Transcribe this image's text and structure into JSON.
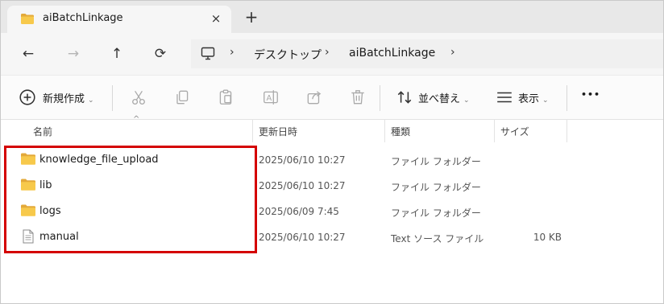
{
  "tab": {
    "title": "aiBatchLinkage",
    "close": "×",
    "new_tab": "+"
  },
  "nav": {
    "back": "←",
    "forward": "→",
    "up": "↑",
    "refresh": "⟳"
  },
  "breadcrumb": {
    "sep": "›",
    "items": [
      "デスクトップ",
      "aiBatchLinkage"
    ]
  },
  "toolbar": {
    "new_label": "新規作成",
    "sort_label": "並べ替え",
    "view_label": "表示",
    "more": "•••",
    "chevron": "⌄"
  },
  "columns": {
    "name": "名前",
    "modified": "更新日時",
    "type": "種類",
    "size": "サイズ",
    "sort_indicator": "^"
  },
  "files": [
    {
      "name": "knowledge_file_upload",
      "modified": "2025/06/10 10:27",
      "type": "ファイル フォルダー",
      "size": "",
      "icon": "folder-icon"
    },
    {
      "name": "lib",
      "modified": "2025/06/10 10:27",
      "type": "ファイル フォルダー",
      "size": "",
      "icon": "folder-icon"
    },
    {
      "name": "logs",
      "modified": "2025/06/09 7:45",
      "type": "ファイル フォルダー",
      "size": "",
      "icon": "folder-icon"
    },
    {
      "name": "manual",
      "modified": "2025/06/10 10:27",
      "type": "Text ソース ファイル",
      "size": "10 KB",
      "icon": "text-file-icon"
    }
  ],
  "colors": {
    "accent_folder": "#f7c94b",
    "highlight": "#d40000"
  }
}
